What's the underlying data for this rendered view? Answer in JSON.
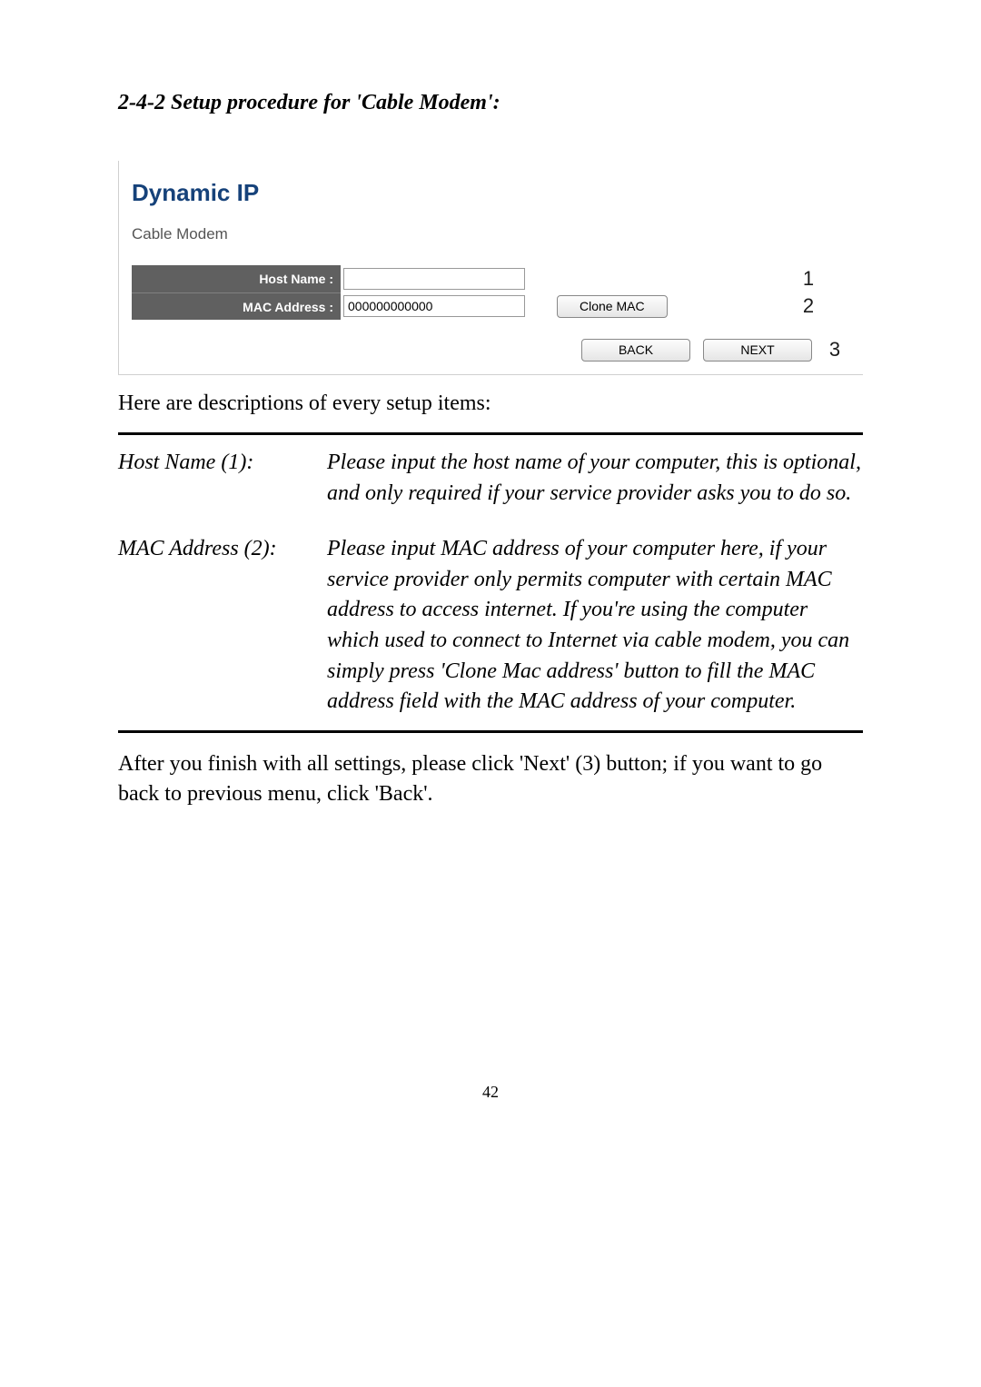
{
  "section_title": "2-4-2 Setup procedure for 'Cable Modem':",
  "panel": {
    "title": "Dynamic IP",
    "subtitle": "Cable Modem",
    "host_name_label": "Host Name :",
    "host_name_value": "",
    "mac_address_label": "MAC Address :",
    "mac_address_value": "000000000000",
    "clone_mac_label": "Clone MAC",
    "back_label": "BACK",
    "next_label": "NEXT",
    "num1": "1",
    "num2": "2",
    "num3": "3"
  },
  "desc_intro": "Here are descriptions of every setup items:",
  "items": [
    {
      "label": "Host Name (1):",
      "text": "Please input the host name of your computer, this is optional, and only required if your service provider asks you to do so."
    },
    {
      "label": "MAC Address (2):",
      "text": "Please input MAC address of your computer here, if your service provider only permits computer with certain MAC address to access internet. If you're using the computer which used to connect to Internet via cable modem, you can simply press 'Clone Mac address' button to fill the MAC address field with the MAC address of your computer."
    }
  ],
  "footer_text": "After you finish with all settings, please click 'Next' (3) button; if you want to go back to previous menu, click 'Back'.",
  "page_number": "42"
}
